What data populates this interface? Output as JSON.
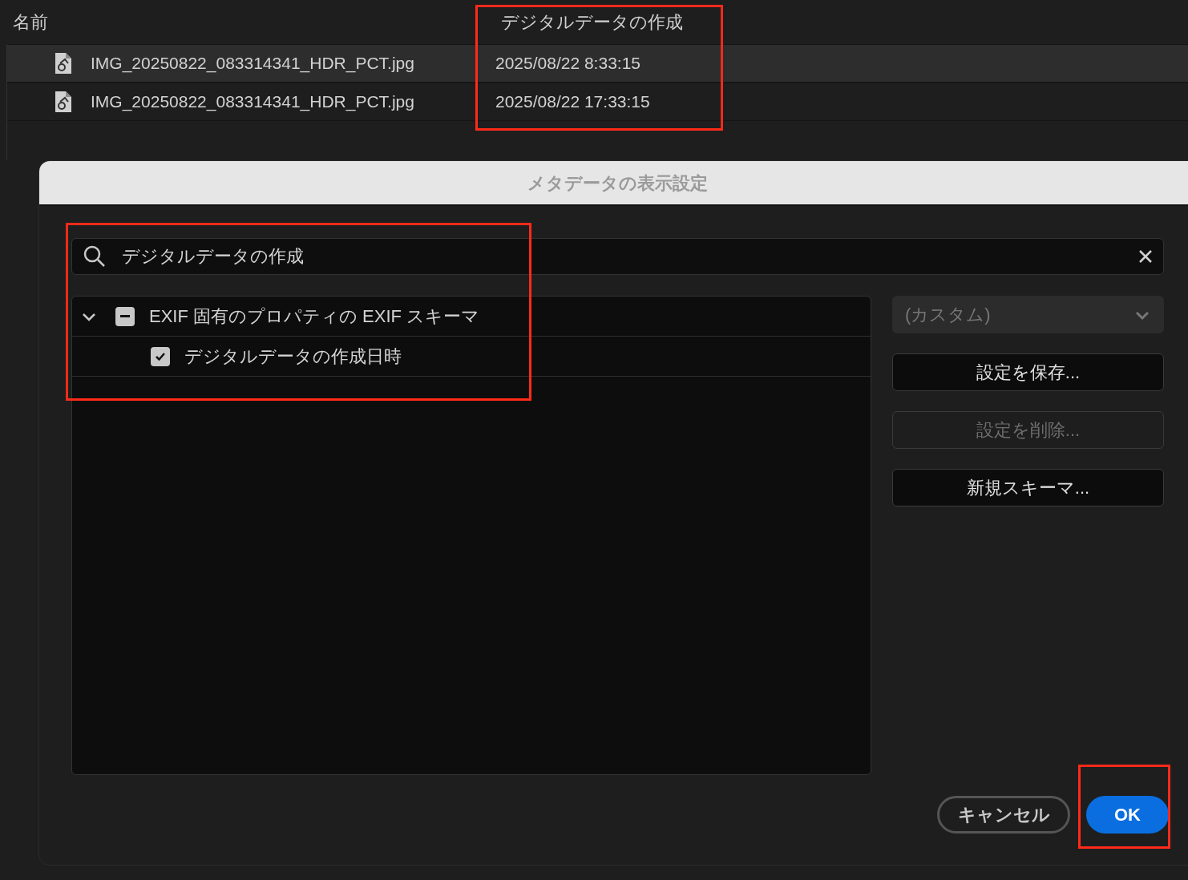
{
  "table": {
    "columns": [
      "名前",
      "デジタルデータの作成"
    ],
    "rows": [
      {
        "name": "IMG_20250822_083314341_HDR_PCT.jpg",
        "created": "2025/08/22 8:33:15",
        "selected": true
      },
      {
        "name": "IMG_20250822_083314341_HDR_PCT.jpg",
        "created": "2025/08/22 17:33:15",
        "selected": false
      }
    ]
  },
  "dialog": {
    "title": "メタデータの表示設定",
    "search": {
      "value": "デジタルデータの作成"
    },
    "tree": [
      {
        "label": "EXIF 固有のプロパティの EXIF スキーマ",
        "mixed": true,
        "expanded": true,
        "children": [
          {
            "label": "デジタルデータの作成日時",
            "checked": true
          }
        ]
      }
    ],
    "preset": {
      "value": "(カスタム)",
      "disabled": true
    },
    "buttons": [
      {
        "label": "設定を保存...",
        "disabled": false
      },
      {
        "label": "設定を削除...",
        "disabled": true
      },
      {
        "label": "新規スキーマ...",
        "disabled": false
      }
    ],
    "cancel": "キャンセル",
    "ok": "OK"
  }
}
